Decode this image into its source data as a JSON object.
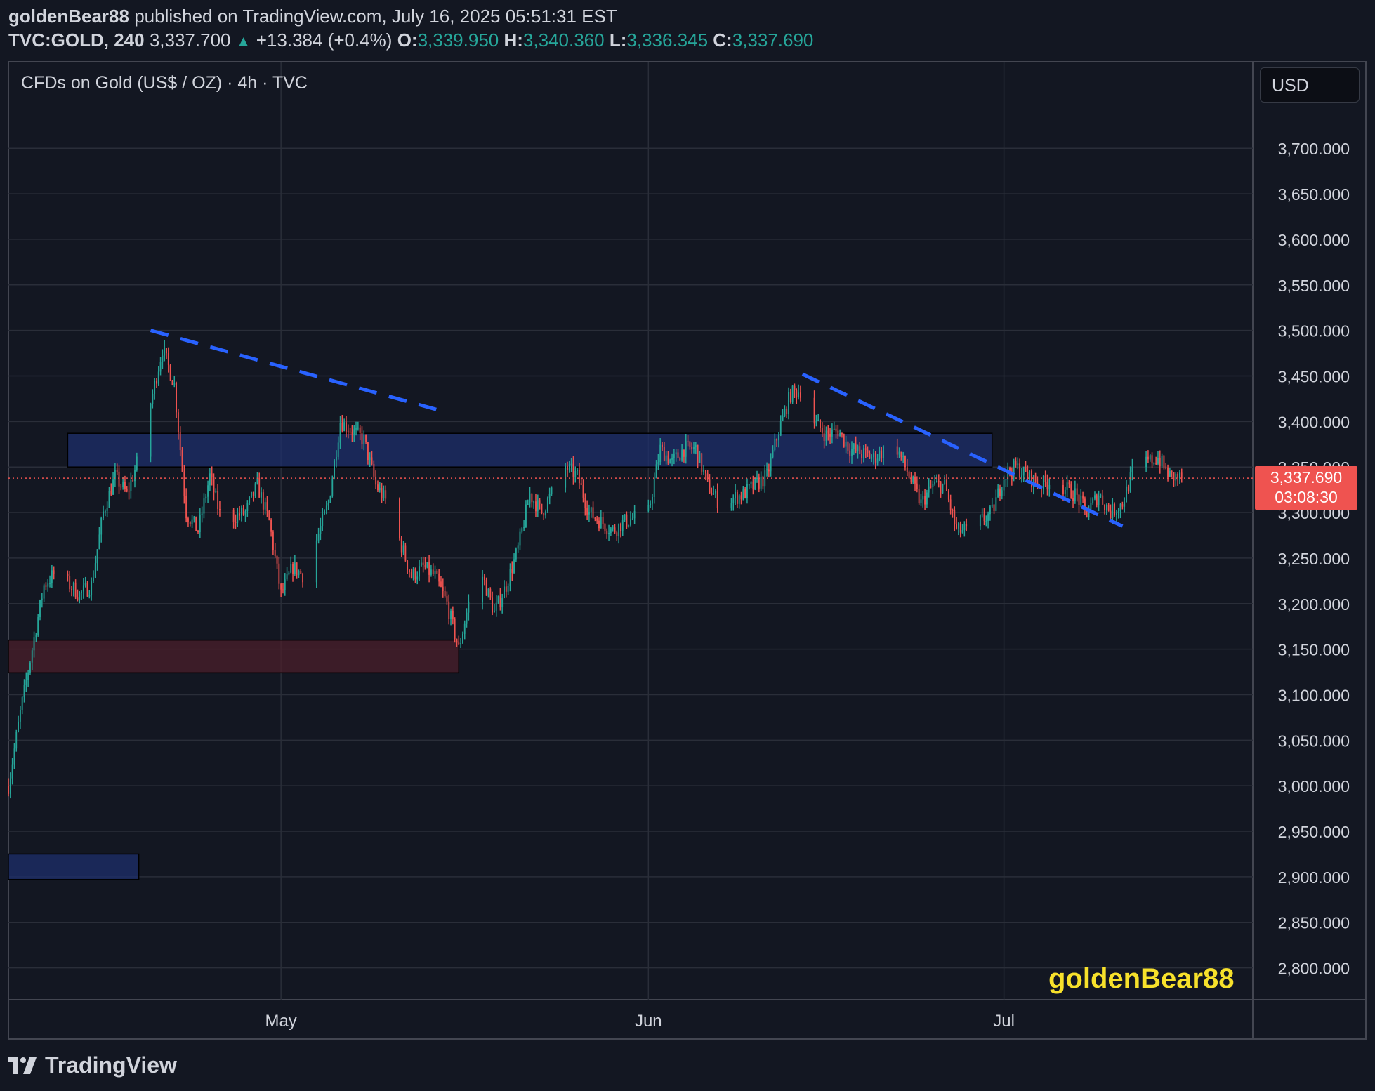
{
  "header": {
    "author": "goldenBear88",
    "published": "published on TradingView.com, July 16, 2025 05:51:31 EST",
    "symbol": "TVC:GOLD, 240",
    "last": "3,337.700",
    "change": "+13.384 (+0.4%)",
    "o_label": "O:",
    "o": "3,339.950",
    "h_label": "H:",
    "h": "3,340.360",
    "l_label": "L:",
    "l": "3,336.345",
    "c_label": "C:",
    "c": "3,337.690"
  },
  "chart_title": "CFDs on Gold (US$ / OZ) · 4h · TVC",
  "currency": "USD",
  "price_tag": {
    "price": "3,337.690",
    "countdown": "03:08:30"
  },
  "watermark": "goldenBear88",
  "brand": "TradingView",
  "colors": {
    "up": "#26a69a",
    "down": "#ef5350",
    "trendline": "#2962ff",
    "background": "#131722",
    "watermark": "#f7e12b"
  },
  "chart_data": {
    "type": "candlestick",
    "timeframe": "4h",
    "x_tick_labels": [
      "May",
      "Jun",
      "Jul"
    ],
    "y_tick_labels": [
      "3,700.000",
      "3,650.000",
      "3,600.000",
      "3,550.000",
      "3,500.000",
      "3,450.000",
      "3,400.000",
      "3,350.000",
      "3,300.000",
      "3,250.000",
      "3,200.000",
      "3,150.000",
      "3,100.000",
      "3,050.000",
      "3,000.000",
      "2,950.000",
      "2,900.000",
      "2,850.000",
      "2,800.000"
    ],
    "y_ticks": [
      3700,
      3650,
      3600,
      3550,
      3500,
      3450,
      3400,
      3350,
      3300,
      3250,
      3200,
      3150,
      3100,
      3050,
      3000,
      2950,
      2900,
      2850,
      2800
    ],
    "ylim": [
      2765,
      3795
    ],
    "x_range": [
      "2025-04-08",
      "2025-07-22"
    ],
    "x_ticks": [
      "2025-05-01",
      "2025-06-01",
      "2025-07-01"
    ],
    "grid": true,
    "last_price": 3337.69,
    "anchors": [
      [
        "2025-04-08",
        3000
      ],
      [
        "2025-04-09",
        3080
      ],
      [
        "2025-04-10",
        3150
      ],
      [
        "2025-04-11",
        3220
      ],
      [
        "2025-04-12",
        3235
      ],
      [
        "2025-04-14",
        3210
      ],
      [
        "2025-04-15",
        3220
      ],
      [
        "2025-04-16",
        3300
      ],
      [
        "2025-04-17",
        3340
      ],
      [
        "2025-04-18",
        3320
      ],
      [
        "2025-04-19",
        3360
      ],
      [
        "2025-04-20",
        3420
      ],
      [
        "2025-04-21",
        3480
      ],
      [
        "2025-04-22",
        3440
      ],
      [
        "2025-04-23",
        3300
      ],
      [
        "2025-04-24",
        3280
      ],
      [
        "2025-04-25",
        3340
      ],
      [
        "2025-04-26",
        3290
      ],
      [
        "2025-04-28",
        3300
      ],
      [
        "2025-04-29",
        3330
      ],
      [
        "2025-04-30",
        3290
      ],
      [
        "2025-05-01",
        3210
      ],
      [
        "2025-05-02",
        3240
      ],
      [
        "2025-05-03",
        3230
      ],
      [
        "2025-05-05",
        3310
      ],
      [
        "2025-05-06",
        3400
      ],
      [
        "2025-05-07",
        3390
      ],
      [
        "2025-05-08",
        3380
      ],
      [
        "2025-05-09",
        3330
      ],
      [
        "2025-05-10",
        3310
      ],
      [
        "2025-05-12",
        3230
      ],
      [
        "2025-05-13",
        3240
      ],
      [
        "2025-05-14",
        3230
      ],
      [
        "2025-05-15",
        3200
      ],
      [
        "2025-05-16",
        3150
      ],
      [
        "2025-05-17",
        3210
      ],
      [
        "2025-05-18",
        3230
      ],
      [
        "2025-05-19",
        3190
      ],
      [
        "2025-05-20",
        3220
      ],
      [
        "2025-05-21",
        3260
      ],
      [
        "2025-05-22",
        3320
      ],
      [
        "2025-05-23",
        3300
      ],
      [
        "2025-05-25",
        3350
      ],
      [
        "2025-05-26",
        3340
      ],
      [
        "2025-05-27",
        3300
      ],
      [
        "2025-05-28",
        3290
      ],
      [
        "2025-05-29",
        3280
      ],
      [
        "2025-05-30",
        3290
      ],
      [
        "2025-06-01",
        3300
      ],
      [
        "2025-06-02",
        3370
      ],
      [
        "2025-06-03",
        3355
      ],
      [
        "2025-06-04",
        3370
      ],
      [
        "2025-06-05",
        3370
      ],
      [
        "2025-06-06",
        3330
      ],
      [
        "2025-06-07",
        3310
      ],
      [
        "2025-06-09",
        3320
      ],
      [
        "2025-06-10",
        3330
      ],
      [
        "2025-06-11",
        3340
      ],
      [
        "2025-06-12",
        3390
      ],
      [
        "2025-06-13",
        3430
      ],
      [
        "2025-06-14",
        3435
      ],
      [
        "2025-06-15",
        3400
      ],
      [
        "2025-06-16",
        3385
      ],
      [
        "2025-06-17",
        3390
      ],
      [
        "2025-06-18",
        3370
      ],
      [
        "2025-06-19",
        3365
      ],
      [
        "2025-06-20",
        3360
      ],
      [
        "2025-06-21",
        3370
      ],
      [
        "2025-06-22",
        3370
      ],
      [
        "2025-06-23",
        3340
      ],
      [
        "2025-06-24",
        3310
      ],
      [
        "2025-06-25",
        3330
      ],
      [
        "2025-06-26",
        3330
      ],
      [
        "2025-06-27",
        3280
      ],
      [
        "2025-06-28",
        3280
      ],
      [
        "2025-06-30",
        3300
      ],
      [
        "2025-07-01",
        3340
      ],
      [
        "2025-07-02",
        3350
      ],
      [
        "2025-07-03",
        3340
      ],
      [
        "2025-07-04",
        3330
      ],
      [
        "2025-07-05",
        3335
      ],
      [
        "2025-07-07",
        3320
      ],
      [
        "2025-07-08",
        3300
      ],
      [
        "2025-07-09",
        3320
      ],
      [
        "2025-07-10",
        3300
      ],
      [
        "2025-07-11",
        3310
      ],
      [
        "2025-07-12",
        3350
      ],
      [
        "2025-07-14",
        3360
      ],
      [
        "2025-07-15",
        3340
      ],
      [
        "2025-07-16",
        3337.69
      ]
    ],
    "zones": [
      {
        "color": "#1e2f6b",
        "from": "2025-04-13",
        "to": "2025-06-30",
        "low": 3350,
        "high": 3387
      },
      {
        "color": "#4b1f2b",
        "from": "2025-04-08",
        "to": "2025-05-16",
        "low": 3124,
        "high": 3160
      },
      {
        "color": "#1e2f6b",
        "from": "2025-04-08",
        "to": "2025-04-19",
        "low": 2897,
        "high": 2925
      }
    ],
    "trendlines": [
      {
        "from": [
          "2025-04-20",
          3500
        ],
        "to": [
          "2025-05-15",
          3410
        ]
      },
      {
        "from": [
          "2025-06-14",
          3452
        ],
        "to": [
          "2025-07-11",
          3285
        ]
      }
    ]
  }
}
